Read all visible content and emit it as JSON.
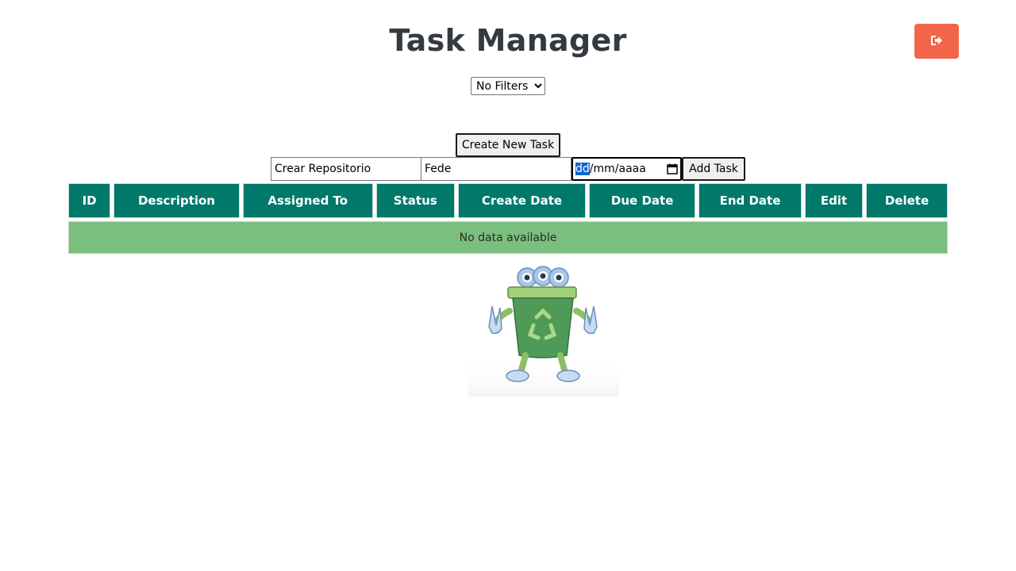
{
  "header": {
    "title": "Task Manager",
    "logout_icon": "logout-icon",
    "logout_color": "#f36549"
  },
  "filter": {
    "selected": "No Filters"
  },
  "create_button_label": "Create New Task",
  "new_task_form": {
    "description_value": "Crear Repositorio",
    "assigned_to_value": "Fede",
    "date_day": "dd",
    "date_rest": "/mm/aaaa",
    "calendar_icon": "calendar-icon",
    "add_button_label": "Add Task"
  },
  "table": {
    "header_color": "#00796b",
    "columns": [
      "ID",
      "Description",
      "Assigned To",
      "Status",
      "Create Date",
      "Due Date",
      "End Date",
      "Edit",
      "Delete"
    ],
    "empty_message": "No data available",
    "empty_color": "#7bbf7f"
  },
  "illustration": {
    "icon": "recycle-bin-mascot"
  }
}
